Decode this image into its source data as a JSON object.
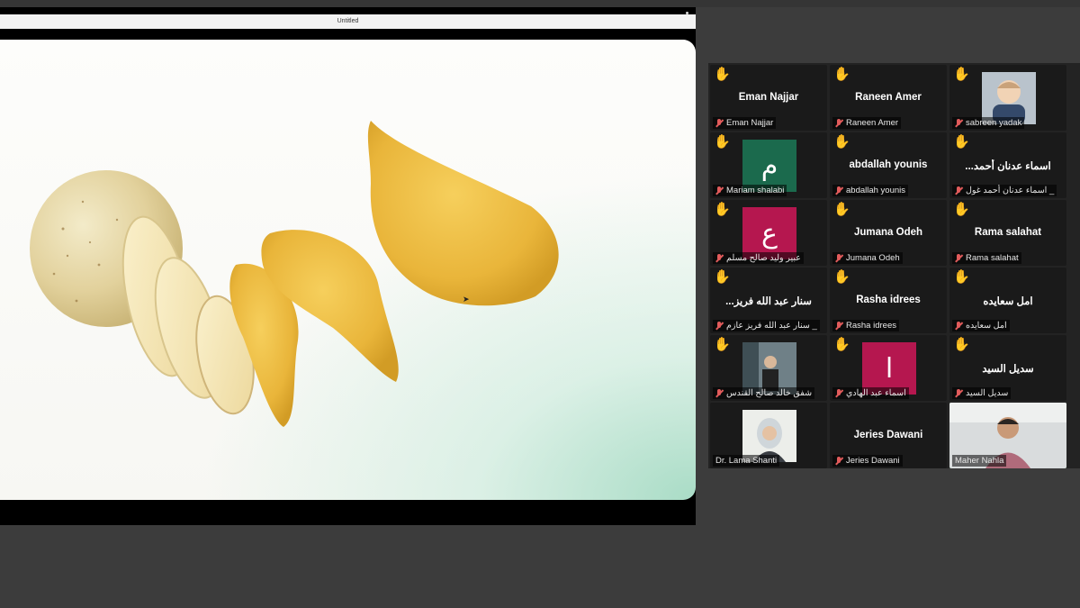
{
  "shared_window": {
    "title": "Untitled"
  },
  "gallery": {
    "tiles": [
      {
        "name": "Eman Najjar",
        "label": "Eman Najjar",
        "hand": true,
        "type": "name"
      },
      {
        "name": "Raneen Amer",
        "label": "Raneen Amer",
        "hand": true,
        "type": "name"
      },
      {
        "name": "",
        "label": "sabreen yadak",
        "hand": true,
        "type": "photo-child"
      },
      {
        "name": "",
        "label": "Mariam shalabi",
        "hand": true,
        "type": "letter",
        "letter": "م",
        "color": "#1b6a4d"
      },
      {
        "name": "abdallah younis",
        "label": "abdallah younis",
        "hand": true,
        "type": "name"
      },
      {
        "name": "اسماء عدنان أحمد...",
        "label": "اسماء عدنان أحمد غول _",
        "hand": true,
        "type": "name-rtl"
      },
      {
        "name": "",
        "label": "عبير وليد صالح مسلم",
        "hand": true,
        "type": "letter",
        "letter": "ع",
        "color": "#b5174f"
      },
      {
        "name": "Jumana Odeh",
        "label": "Jumana Odeh",
        "hand": true,
        "type": "name"
      },
      {
        "name": "Rama salahat",
        "label": "Rama salahat",
        "hand": true,
        "type": "name"
      },
      {
        "name": "سنار عبد الله فريز...",
        "label": "سنار عبد الله فريز عازم _",
        "hand": true,
        "type": "name-rtl"
      },
      {
        "name": "Rasha idrees",
        "label": "Rasha idrees",
        "hand": true,
        "type": "name"
      },
      {
        "name": "امل سعايده",
        "label": "امل سعايده",
        "hand": true,
        "type": "name-rtl"
      },
      {
        "name": "",
        "label": "شفق خالد صالح القندس",
        "hand": true,
        "type": "photo-man"
      },
      {
        "name": "",
        "label": "اسماء عبد الهادي",
        "hand": true,
        "type": "letter",
        "letter": "ا",
        "color": "#b5174f"
      },
      {
        "name": "سديل السيد",
        "label": "سديل السيد",
        "hand": true,
        "type": "name-rtl"
      },
      {
        "name": "",
        "label": "Dr. Lama Shanti",
        "hand": false,
        "type": "photo-woman"
      },
      {
        "name": "Jeries Dawani",
        "label": "Jeries Dawani",
        "hand": false,
        "type": "name"
      },
      {
        "name": "",
        "label": "Maher Nahla",
        "hand": false,
        "type": "video-host",
        "active": true
      }
    ]
  },
  "colors": {
    "gallery_bg": "#232323",
    "active_speaker": "#39b86a",
    "mute_red": "#e15b5b",
    "hand_yellow": "#f5c518"
  }
}
